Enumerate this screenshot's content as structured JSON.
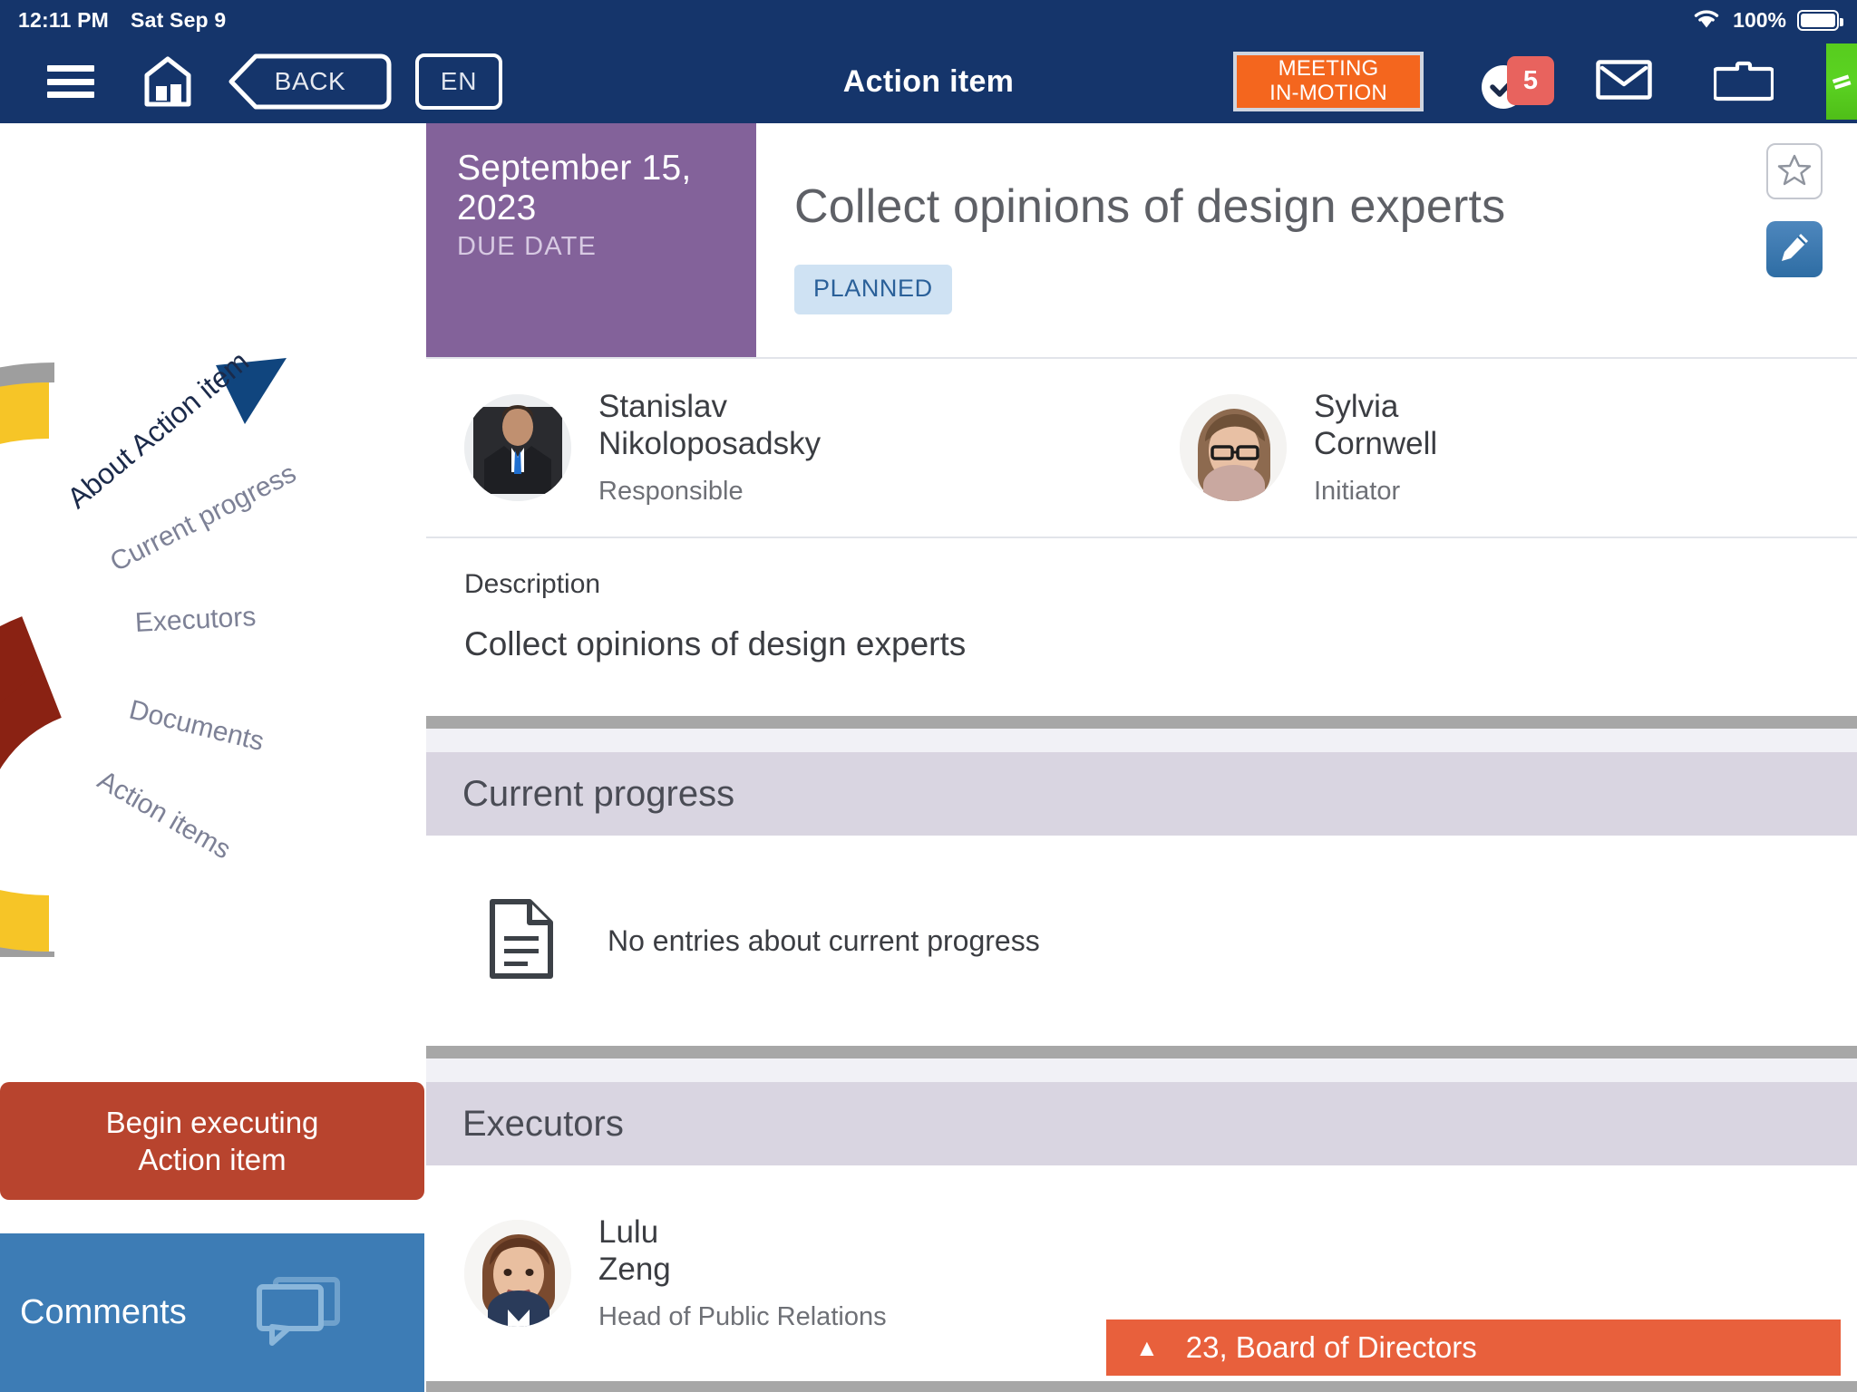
{
  "status_bar": {
    "time": "12:11 PM",
    "date": "Sat Sep 9",
    "battery_percent": "100%",
    "wifi_icon": "wifi-icon",
    "battery_icon": "battery-icon"
  },
  "navbar": {
    "menu_icon": "hamburger-menu-icon",
    "home_icon": "home-icon",
    "back_label": "BACK",
    "language_label": "EN",
    "title": "Action item",
    "meeting_status_line1": "MEETING",
    "meeting_status_line2": "IN-MOTION",
    "tasks_icon": "checkmark-circle-icon",
    "tasks_badge": "5",
    "mail_icon": "envelope-icon",
    "folder_icon": "folder-icon",
    "green_tab_icon": "equals-icon"
  },
  "sidebar": {
    "pointer_icon": "triangle-pointer-icon",
    "wheel_items": [
      {
        "label": "About Action item",
        "active": true
      },
      {
        "label": "Current progress",
        "active": false
      },
      {
        "label": "Executors",
        "active": false
      },
      {
        "label": "Documents",
        "active": false
      },
      {
        "label": "Action items",
        "active": false
      }
    ],
    "begin_button_line1": "Begin executing",
    "begin_button_line2": "Action item",
    "comments_label": "Comments",
    "comments_icon": "speech-bubbles-icon",
    "colors": {
      "begin_button": "#b8442e",
      "comments_button": "#3d7cb5",
      "arc_outer": "#9e9e9e",
      "arc_yellow": "#f6c527",
      "arc_dark_red": "#8a2213",
      "arc_black": "#333333",
      "arc_light_blue": "#a8d4f5",
      "arc_light_gray": "#cccccc"
    }
  },
  "main": {
    "due_date": "September 15, 2023",
    "due_date_label": "DUE DATE",
    "title": "Collect opinions of design experts",
    "status": "PLANNED",
    "star_icon": "star-outline-icon",
    "edit_icon": "pencil-icon",
    "people": [
      {
        "name_line1": "Stanislav",
        "name_line2": "Nikoloposadsky",
        "role": "Responsible",
        "avatar_icon": "avatar-photo-male"
      },
      {
        "name_line1": "Sylvia",
        "name_line2": "Cornwell",
        "role": "Initiator",
        "avatar_icon": "avatar-photo-female-glasses"
      }
    ],
    "description_label": "Description",
    "description_text": "Collect opinions of design experts",
    "current_progress": {
      "heading": "Current progress",
      "empty_text": "No entries about current progress",
      "empty_icon": "document-lines-icon"
    },
    "executors": {
      "heading": "Executors",
      "items": [
        {
          "name_line1": "Lulu",
          "name_line2": "Zeng",
          "role": "Head of Public Relations",
          "avatar_icon": "avatar-photo-female"
        }
      ]
    },
    "bottom_banner": {
      "arrow_icon": "triangle-up-icon",
      "text": "23, Board of Directors"
    },
    "colors": {
      "due_card": "#83629a",
      "status_pill_bg": "#cfe2f3",
      "status_pill_text": "#2a6099",
      "section_head": "#d9d5e1",
      "banner": "#e8603c",
      "nav_bar": "#15356b",
      "meeting_chip": "#f4661e"
    }
  }
}
